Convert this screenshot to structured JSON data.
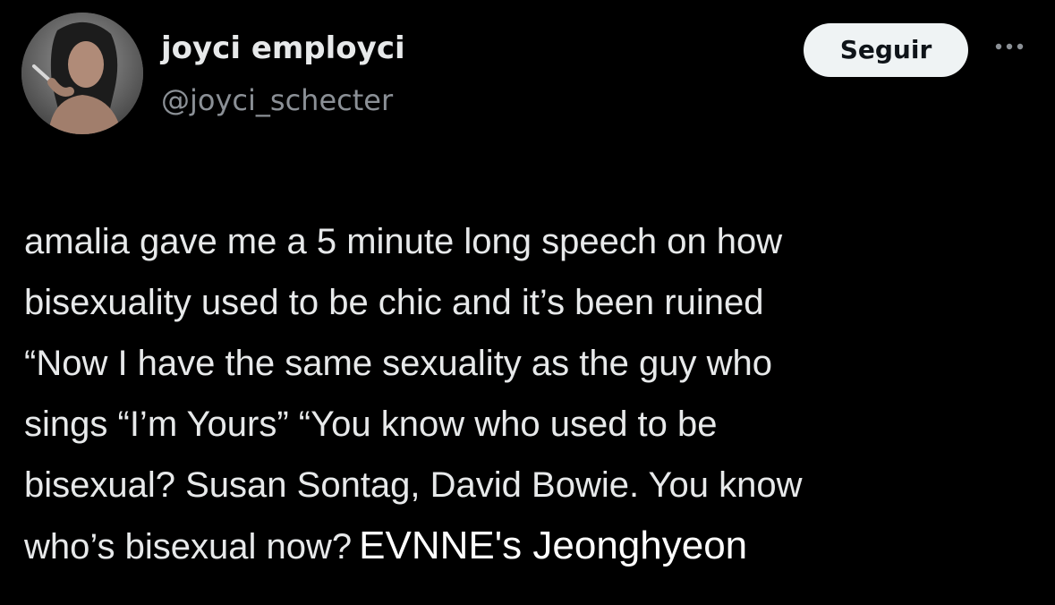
{
  "author": {
    "display_name": "joyci employci",
    "handle": "@joyci_schecter",
    "avatar_icon": "profile-photo"
  },
  "actions": {
    "follow_label": "Seguir",
    "more_icon": "more-options-icon"
  },
  "tweet": {
    "lines": [
      "amalia gave me a 5 minute long speech on how",
      "bisexuality used to be chic and it’s been ruined",
      " “Now I have the same sexuality as the guy who",
      "sings “I’m Yours” “You know who used to be",
      "bisexual? Susan Sontag, David Bowie. You know",
      "who’s bisexual now?"
    ],
    "overlay_caption": "EVNNE's Jeonghyeon"
  },
  "colors": {
    "background": "#000000",
    "text_primary": "#e7e9ea",
    "text_secondary": "#8b9096",
    "button_bg": "#eff3f4",
    "button_text": "#0f1419"
  }
}
